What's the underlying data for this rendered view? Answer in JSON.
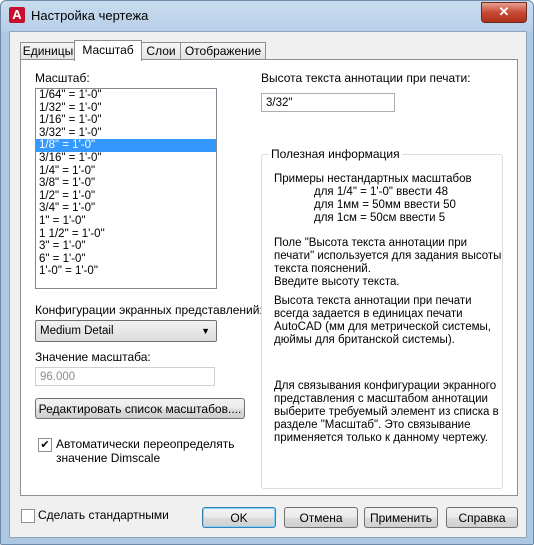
{
  "window": {
    "title": "Настройка чертежа",
    "close_glyph": "✕",
    "app_glyph": "A"
  },
  "tabs": [
    {
      "label": "Единицы"
    },
    {
      "label": "Масштаб"
    },
    {
      "label": "Слои"
    },
    {
      "label": "Отображение"
    }
  ],
  "scale": {
    "label": "Масштаб:",
    "items": [
      "1/64\" = 1'-0\"",
      "1/32\" = 1'-0\"",
      "1/16\" = 1'-0\"",
      "3/32\" = 1'-0\"",
      "1/8\" = 1'-0\"",
      "3/16\" = 1'-0\"",
      "1/4\" = 1'-0\"",
      "3/8\" = 1'-0\"",
      "1/2\" = 1'-0\"",
      "3/4\" = 1'-0\"",
      "1\" = 1'-0\"",
      "1 1/2\" = 1'-0\"",
      "3\" = 1'-0\"",
      "6\" = 1'-0\"",
      "1'-0\" = 1'-0\""
    ],
    "selected_index": 4
  },
  "display_config": {
    "label": "Конфигурации экранных представлений:",
    "value": "Medium Detail"
  },
  "scale_value": {
    "label": "Значение масштаба:",
    "value": "96.000"
  },
  "edit_scale_list_button": "Редактировать список масштабов....",
  "auto_dimscale": {
    "line1": "Автоматически переопределять",
    "line2": "значение Dimscale",
    "checked": true
  },
  "annotation_height": {
    "label": "Высота текста аннотации при печати:",
    "value": "3/32\""
  },
  "info_group": {
    "title": "Полезная информация",
    "examples_header": "Примеры нестандартных масштабов",
    "example1": "для 1/4\" = 1'-0\" ввести 48",
    "example2": "для 1мм = 50мм ввести 50",
    "example3": "для 1см = 50см ввести 5",
    "para1": [
      "Поле \"Высота текста аннотации при",
      "печати\" используется для задания высоты",
      "текста пояснений.",
      "Введите высоту текста."
    ],
    "para2": [
      "Высота текста аннотации при печати",
      "всегда задается в единицах печати",
      "AutoCAD (мм для метрической системы,",
      "дюймы для британской системы)."
    ],
    "para3": [
      "Для связывания конфигурации экранного",
      "представления с масштабом аннотации",
      "выберите требуемый элемент из списка в",
      "разделе \"Масштаб\". Это связывание",
      "применяется только к данному чертежу."
    ]
  },
  "footer": {
    "make_default": "Сделать стандартными",
    "ok": "OK",
    "cancel": "Отмена",
    "apply": "Применить",
    "help": "Справка"
  }
}
